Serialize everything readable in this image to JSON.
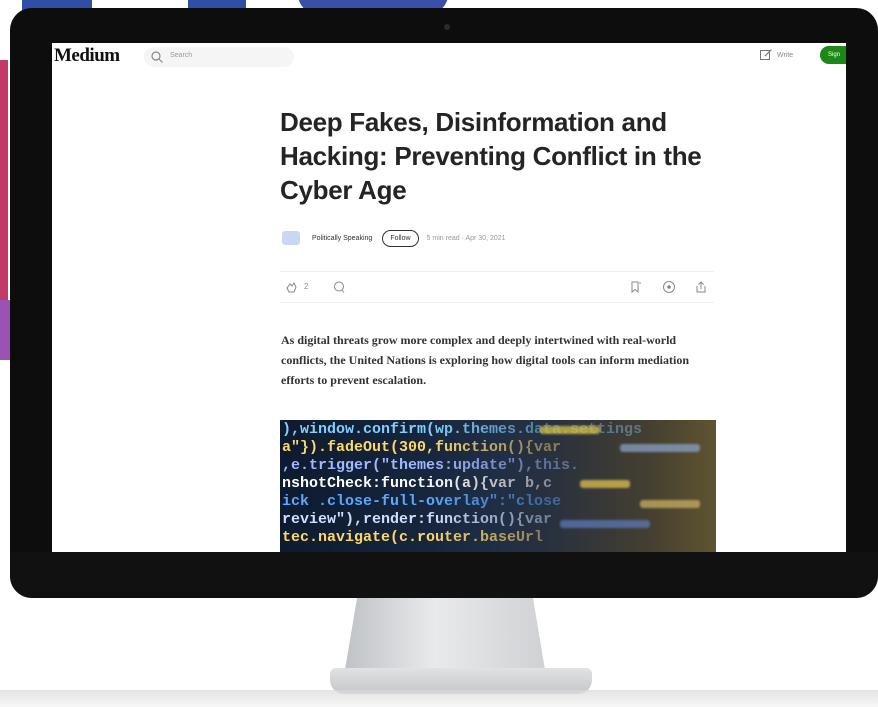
{
  "header": {
    "logo": "Medium",
    "search_placeholder": "Search",
    "write_label": "Write",
    "signup_label": "Sign"
  },
  "article": {
    "title": "Deep Fakes, Disinformation and Hacking: Preventing Conflict in the Cyber Age",
    "author": "Politically Speaking",
    "follow_label": "Follow",
    "meta": "5 min read · Apr 30, 2021",
    "clap_count": "2",
    "lede": "As digital threats grow more complex and deeply intertwined with real-world conflicts, the United Nations is exploring how digital tools can inform mediation efforts to prevent escalation."
  },
  "hero_code": [
    {
      "text": "),window.confirm(wp.themes.data.settings",
      "color": "#7fd0ff"
    },
    {
      "text": "a\"}).fadeOut(300,function(){var",
      "color": "#ffd866"
    },
    {
      "text": ",e.trigger(\"themes:update\"),this.",
      "color": "#a0b8ff"
    },
    {
      "text": "nshotCheck:function(a){var b,c",
      "color": "#ffffff"
    },
    {
      "text": "ick .close-full-overlay\":\"close",
      "color": "#5aa8ff"
    },
    {
      "text": "review\"),render:function(){var",
      "color": "#cfe0ff"
    },
    {
      "text": "tec.navigate(c.router.baseUrl",
      "color": "#ffd866"
    }
  ],
  "colors": {
    "brand_green": "#1a8917",
    "text_dark": "#242424"
  }
}
